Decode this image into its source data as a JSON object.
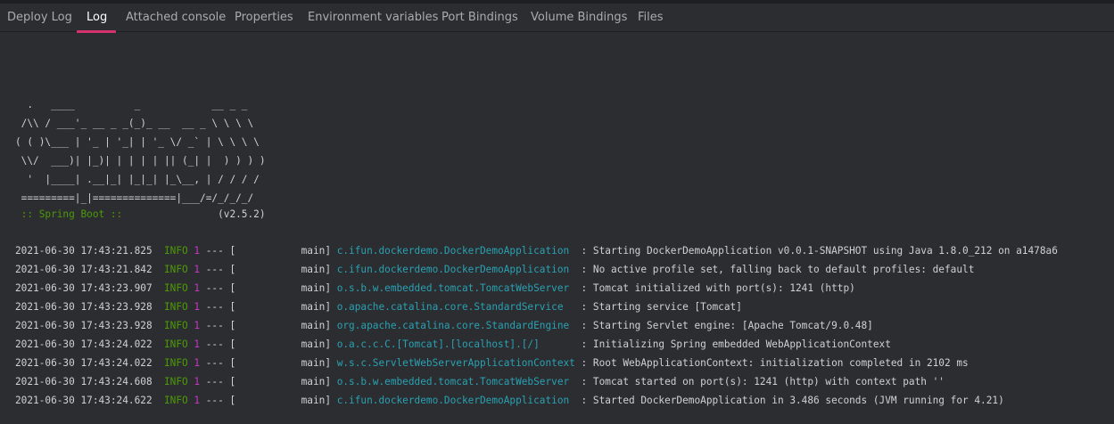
{
  "tabs": [
    {
      "label": "Deploy Log"
    },
    {
      "label": "Log"
    },
    {
      "label": "Attached console"
    },
    {
      "label": "Properties"
    },
    {
      "label": "Environment variables"
    },
    {
      "label": "Port Bindings"
    },
    {
      "label": "Volume Bindings"
    },
    {
      "label": "Files"
    }
  ],
  "active_tab": "Log",
  "colors": {
    "active_underline": "#d6336c",
    "info_level": "#4e9a06",
    "pid": "#c238c2",
    "logger": "#2aa1b3"
  },
  "banner": {
    "lines": [
      "  .   ____          _            __ _ _",
      " /\\\\ / ___'_ __ _ _(_)_ __  __ _ \\ \\ \\ \\",
      "( ( )\\___ | '_ | '_| | '_ \\/ _` | \\ \\ \\ \\",
      " \\\\/  ___)| |_)| | | | | || (_| |  ) ) ) )",
      "  '  |____| .__|_| |_|_| |_\\__, | / / / /",
      " =========|_|==============|___/=/_/_/_/"
    ],
    "spring_label": " :: Spring Boot :: ",
    "spring_version": "               (v2.5.2)"
  },
  "log": {
    "entries": [
      {
        "time": "2021-06-30 17:43:21.825",
        "level": "INFO",
        "pid": "1",
        "thread": "main",
        "logger": "c.ifun.dockerdemo.DockerDemoApplication",
        "message": "Starting DockerDemoApplication v0.0.1-SNAPSHOT using Java 1.8.0_212 on a1478a6"
      },
      {
        "time": "2021-06-30 17:43:21.842",
        "level": "INFO",
        "pid": "1",
        "thread": "main",
        "logger": "c.ifun.dockerdemo.DockerDemoApplication",
        "message": "No active profile set, falling back to default profiles: default"
      },
      {
        "time": "2021-06-30 17:43:23.907",
        "level": "INFO",
        "pid": "1",
        "thread": "main",
        "logger": "o.s.b.w.embedded.tomcat.TomcatWebServer",
        "message": "Tomcat initialized with port(s): 1241 (http)"
      },
      {
        "time": "2021-06-30 17:43:23.928",
        "level": "INFO",
        "pid": "1",
        "thread": "main",
        "logger": "o.apache.catalina.core.StandardService",
        "message": "Starting service [Tomcat]"
      },
      {
        "time": "2021-06-30 17:43:23.928",
        "level": "INFO",
        "pid": "1",
        "thread": "main",
        "logger": "org.apache.catalina.core.StandardEngine",
        "message": "Starting Servlet engine: [Apache Tomcat/9.0.48]"
      },
      {
        "time": "2021-06-30 17:43:24.022",
        "level": "INFO",
        "pid": "1",
        "thread": "main",
        "logger": "o.a.c.c.C.[Tomcat].[localhost].[/]",
        "message": "Initializing Spring embedded WebApplicationContext"
      },
      {
        "time": "2021-06-30 17:43:24.022",
        "level": "INFO",
        "pid": "1",
        "thread": "main",
        "logger": "w.s.c.ServletWebServerApplicationContext",
        "message": "Root WebApplicationContext: initialization completed in 2102 ms"
      },
      {
        "time": "2021-06-30 17:43:24.608",
        "level": "INFO",
        "pid": "1",
        "thread": "main",
        "logger": "o.s.b.w.embedded.tomcat.TomcatWebServer",
        "message": "Tomcat started on port(s): 1241 (http) with context path ''"
      },
      {
        "time": "2021-06-30 17:43:24.622",
        "level": "INFO",
        "pid": "1",
        "thread": "main",
        "logger": "c.ifun.dockerdemo.DockerDemoApplication",
        "message": "Started DockerDemoApplication in 3.486 seconds (JVM running for 4.21)"
      }
    ]
  }
}
